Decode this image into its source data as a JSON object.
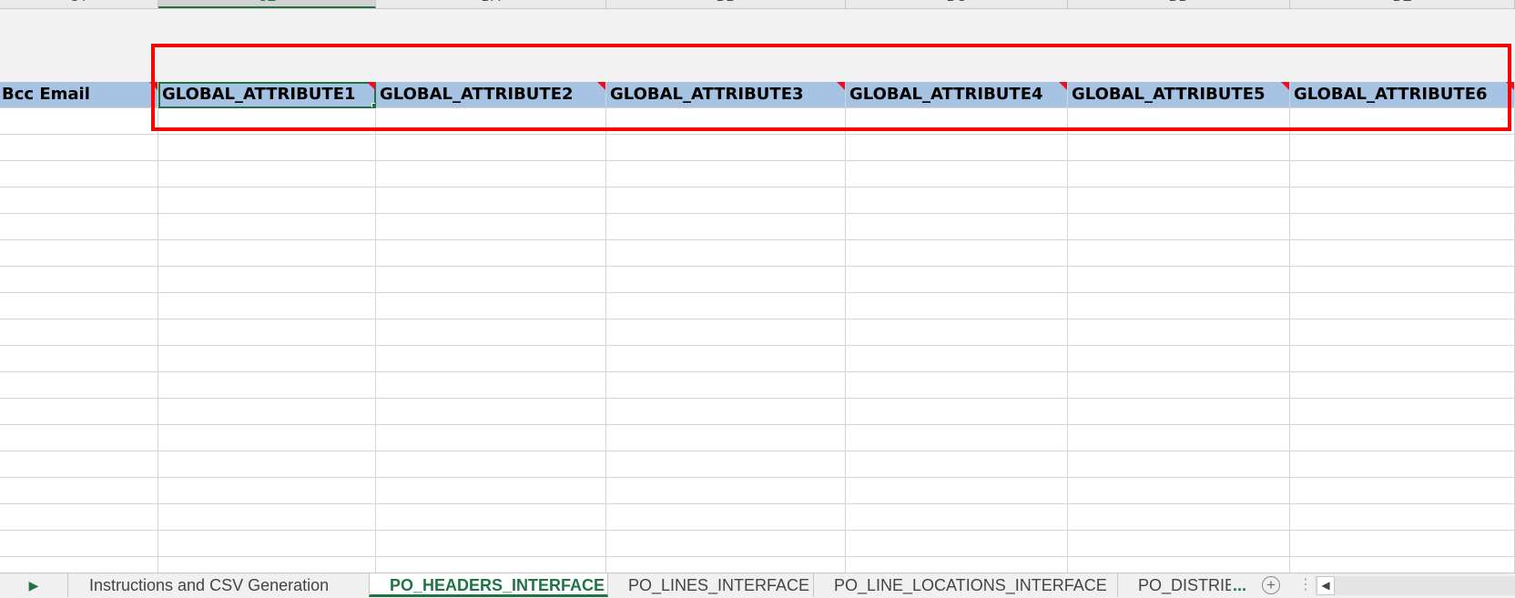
{
  "column_headers": [
    "CY",
    "CZ",
    "DA",
    "DB",
    "DC",
    "DD",
    "DE"
  ],
  "header_row": {
    "cells": [
      "Bcc Email",
      "GLOBAL_ATTRIBUTE1",
      "GLOBAL_ATTRIBUTE2",
      "GLOBAL_ATTRIBUTE3",
      "GLOBAL_ATTRIBUTE4",
      "GLOBAL_ATTRIBUTE5",
      "GLOBAL_ATTRIBUTE6"
    ]
  },
  "sheet_tabs": {
    "nav_arrow": "▶",
    "items": [
      "Instructions and CSV Generation",
      "PO_HEADERS_INTERFACE",
      "PO_LINES_INTERFACE",
      "PO_LINE_LOCATIONS_INTERFACE",
      "PO_DISTRIB"
    ],
    "active_index": 1,
    "more": "...",
    "add": "+",
    "dots": "⋮",
    "scroll_left": "◀"
  },
  "colors": {
    "header_fill": "#a6c3e3",
    "excel_green": "#217346",
    "annotation_red": "#ff0000",
    "comment_marker": "#e81123"
  }
}
